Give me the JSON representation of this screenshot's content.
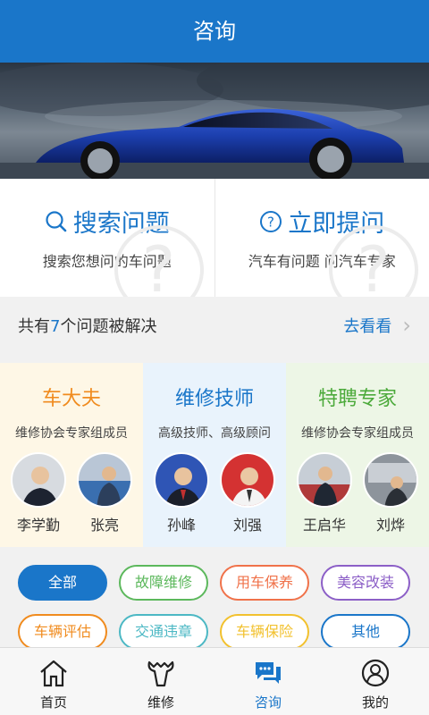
{
  "header": {
    "title": "咨询"
  },
  "actions": [
    {
      "title": "搜索问题",
      "subtitle": "搜索您想问的车问题",
      "icon": "search-icon"
    },
    {
      "title": "立即提问",
      "subtitle": "汽车有问题 问汽车专家",
      "icon": "question-circle-icon"
    }
  ],
  "solved": {
    "prefix": "共有",
    "count": "7",
    "suffix": "个问题被解决",
    "link": "去看看"
  },
  "experts": [
    {
      "title": "车大夫",
      "subtitle": "维修协会专家组成员",
      "people": [
        "李学勤",
        "张亮"
      ]
    },
    {
      "title": "维修技师",
      "subtitle": "高级技师、高级顾问",
      "people": [
        "孙峰",
        "刘强"
      ]
    },
    {
      "title": "特聘专家",
      "subtitle": "维修协会专家组成员",
      "people": [
        "王启华",
        "刘烨"
      ]
    }
  ],
  "tags": [
    {
      "label": "全部",
      "color": "#1a76c9",
      "selected": true
    },
    {
      "label": "故障维修",
      "color": "#5cb85c"
    },
    {
      "label": "用车保养",
      "color": "#f0724a"
    },
    {
      "label": "美容改装",
      "color": "#8c5fc7"
    },
    {
      "label": "车辆评估",
      "color": "#f08b1e"
    },
    {
      "label": "交通违章",
      "color": "#4cb8c4"
    },
    {
      "label": "车辆保险",
      "color": "#f2c12e"
    },
    {
      "label": "其他",
      "color": "#1a76c9"
    }
  ],
  "tabs": [
    {
      "label": "首页",
      "icon": "home-icon"
    },
    {
      "label": "维修",
      "icon": "wrench-icon"
    },
    {
      "label": "咨询",
      "icon": "chat-icon",
      "active": true
    },
    {
      "label": "我的",
      "icon": "user-icon"
    }
  ],
  "colors": {
    "primary": "#1a76c9"
  }
}
